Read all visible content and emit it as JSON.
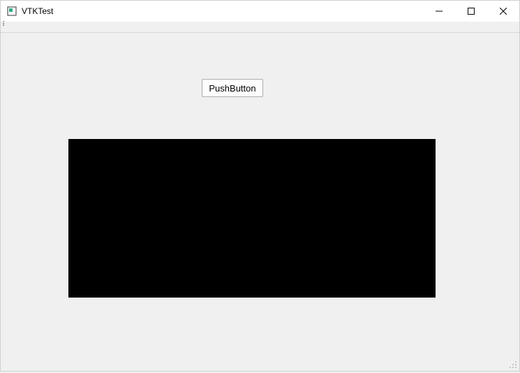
{
  "window": {
    "title": "VTKTest"
  },
  "toolbar": {
    "handle": "⠇"
  },
  "controls": {
    "push_button_label": "PushButton"
  },
  "colors": {
    "render_bg": "#000000",
    "client_bg": "#f0f0f0"
  }
}
